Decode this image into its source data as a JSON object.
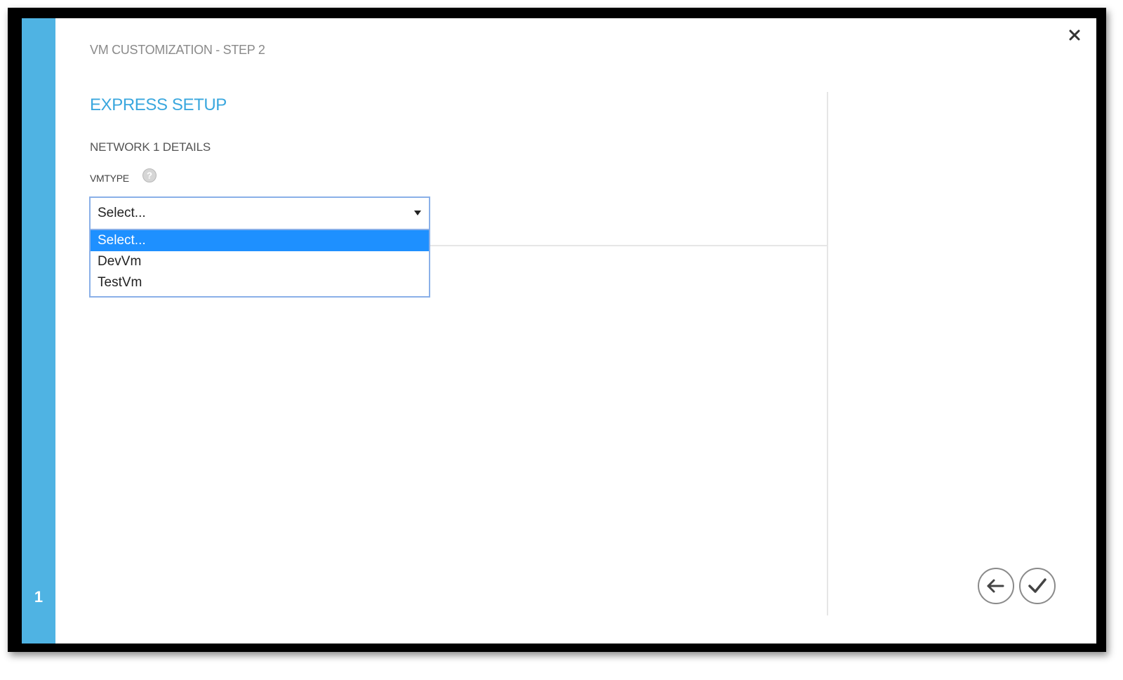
{
  "wizard": {
    "title": "VM CUSTOMIZATION - STEP 2",
    "current_step": "1"
  },
  "section": {
    "title": "EXPRESS SETUP",
    "subtitle": "NETWORK 1 DETAILS"
  },
  "vmtype": {
    "label": "VMTYPE",
    "selected": "Select...",
    "options": [
      "Select...",
      "DevVm",
      "TestVm"
    ],
    "highlighted_option": "Select..."
  },
  "icons": {
    "close": "close-icon",
    "help": "help-icon",
    "dropdown": "dropdown-arrow-icon",
    "back": "arrow-left-icon",
    "finish": "checkmark-icon"
  },
  "colors": {
    "accent": "#4fb3e3",
    "section_title": "#3aa7de",
    "selection": "#1e90ff",
    "select_border": "#8ab0e8"
  }
}
